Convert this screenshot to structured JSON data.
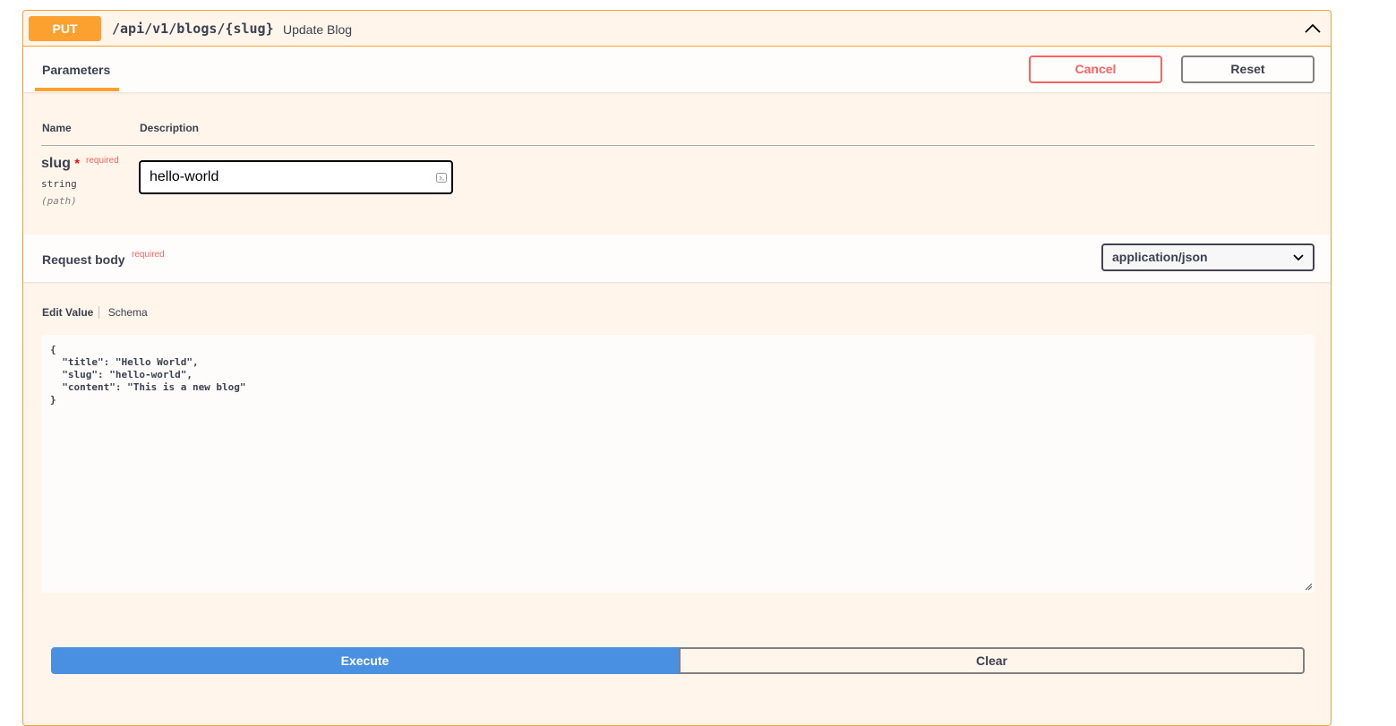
{
  "operation": {
    "method": "PUT",
    "path": "/api/v1/blogs/{slug}",
    "summary": "Update Blog",
    "color": "#fca130"
  },
  "parameters_tab": {
    "label": "Parameters",
    "cancel_label": "Cancel",
    "reset_label": "Reset"
  },
  "parameters_table": {
    "name_header": "Name",
    "description_header": "Description",
    "rows": [
      {
        "name": "slug",
        "required_star": "*",
        "required_label": "required",
        "type": "string",
        "in": "(path)",
        "value": "hello-world"
      }
    ]
  },
  "request_body": {
    "title": "Request body",
    "required_label": "required",
    "content_type": "application/json",
    "tabs": [
      "Edit Value",
      "Schema"
    ],
    "value": "{\n  \"title\": \"Hello World\",\n  \"slug\": \"hello-world\",\n  \"content\": \"This is a new blog\"\n}"
  },
  "actions": {
    "execute_label": "Execute",
    "clear_label": "Clear",
    "execute_color": "#4990e2"
  },
  "icons": [
    "chevron-up-icon",
    "clipboard-icon",
    "chevron-down-icon",
    "resize-grip-icon"
  ]
}
